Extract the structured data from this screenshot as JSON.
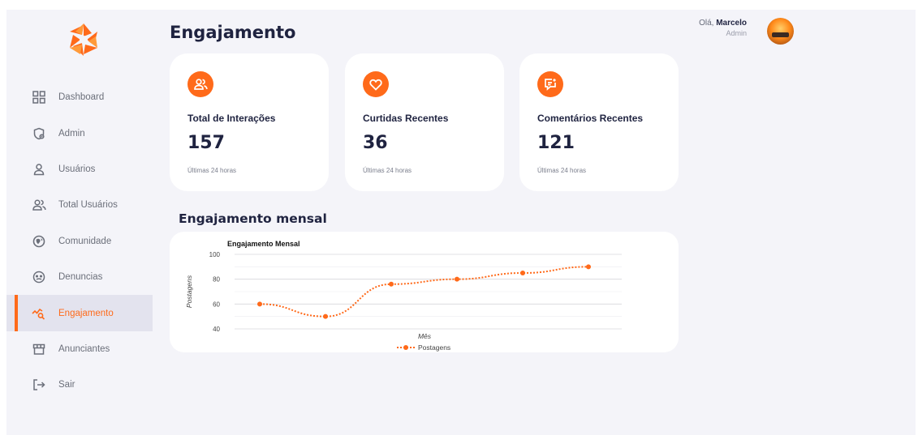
{
  "header": {
    "title": "Engajamento",
    "greeting_prefix": "Olá, ",
    "user_name": "Marcelo",
    "user_role": "Admin"
  },
  "sidebar": {
    "active": "Engajamento",
    "items": [
      {
        "label": "Dashboard",
        "icon": "dashboard-grid-icon"
      },
      {
        "label": "Admin",
        "icon": "admin-shield-icon"
      },
      {
        "label": "Usuários",
        "icon": "user-icon"
      },
      {
        "label": "Total Usuários",
        "icon": "users-icon"
      },
      {
        "label": "Comunidade",
        "icon": "community-icon"
      },
      {
        "label": "Denuncias",
        "icon": "report-icon"
      },
      {
        "label": "Engajamento",
        "icon": "engagement-chart-icon"
      },
      {
        "label": "Anunciantes",
        "icon": "store-icon"
      },
      {
        "label": "Sair",
        "icon": "logout-icon"
      }
    ]
  },
  "cards": [
    {
      "title": "Total de Interações",
      "value": "157",
      "subtitle": "Últimas 24 horas",
      "icon": "users-icon"
    },
    {
      "title": "Curtidas Recentes",
      "value": "36",
      "subtitle": "Últimas 24 horas",
      "icon": "heart-icon"
    },
    {
      "title": "Comentários Recentes",
      "value": "121",
      "subtitle": "Últimas 24 horas",
      "icon": "comment-icon"
    }
  ],
  "section": {
    "title": "Engajamento mensal"
  },
  "colors": {
    "accent": "#ff6a1a",
    "text_dark": "#1f2340",
    "background": "#f4f4f9"
  },
  "chart_data": {
    "type": "line",
    "title": "Engajamento Mensal",
    "xlabel": "Mês",
    "ylabel": "Postagens",
    "ylim": [
      40,
      100
    ],
    "yticks": [
      "100",
      "80",
      "60",
      "40"
    ],
    "grid": true,
    "legend_position": "bottom",
    "series": [
      {
        "name": "Postagens",
        "values": [
          60,
          50,
          76,
          80,
          85,
          90
        ]
      }
    ]
  }
}
